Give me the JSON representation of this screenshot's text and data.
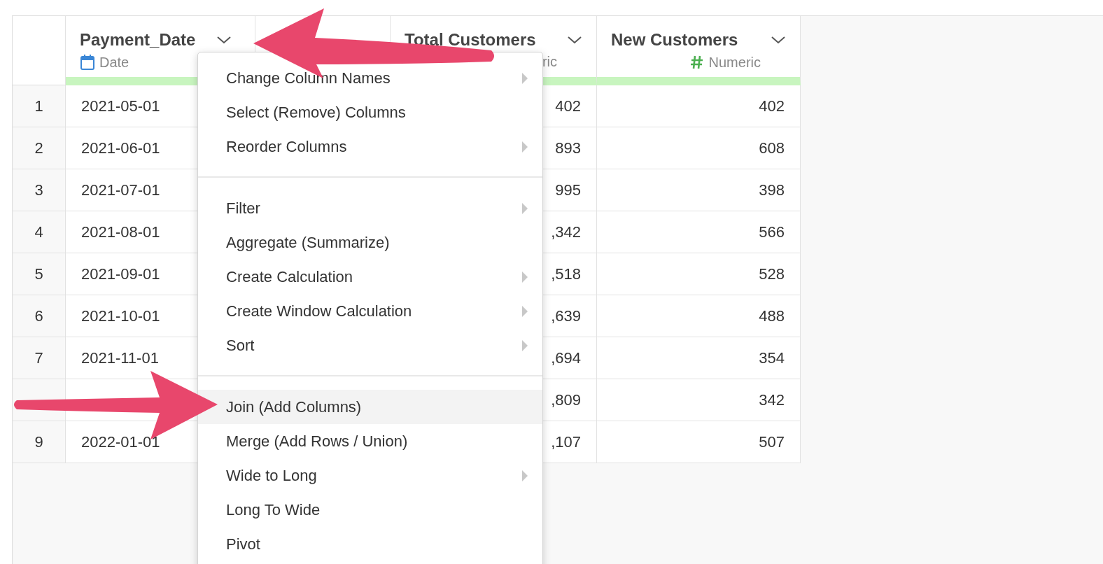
{
  "table": {
    "columns": [
      {
        "name": "Payment_Date",
        "kind": "date",
        "type": "Date"
      },
      {
        "kind": "covered"
      },
      {
        "name": "Total Customers",
        "kind": "plain",
        "type": "ric"
      },
      {
        "name": "New Customers",
        "kind": "numeric",
        "type": "Numeric"
      }
    ],
    "rows": [
      {
        "number": "1",
        "cells": [
          "2021-05-01",
          "402",
          "402"
        ]
      },
      {
        "number": "2",
        "cells": [
          "2021-06-01",
          "893",
          "608"
        ]
      },
      {
        "number": "3",
        "cells": [
          "2021-07-01",
          "995",
          "398"
        ]
      },
      {
        "number": "4",
        "cells": [
          "2021-08-01",
          ",342",
          "566"
        ]
      },
      {
        "number": "5",
        "cells": [
          "2021-09-01",
          ",518",
          "528"
        ]
      },
      {
        "number": "6",
        "cells": [
          "2021-10-01",
          ",639",
          "488"
        ]
      },
      {
        "number": "7",
        "cells": [
          "2021-11-01",
          ",694",
          "354"
        ]
      },
      {
        "cells": [
          null,
          ",809",
          "342"
        ]
      },
      {
        "number": "9",
        "cells": [
          "2022-01-01",
          ",107",
          "507"
        ]
      }
    ]
  },
  "column_menu": {
    "sections": [
      [
        {
          "label": "Change Column Names",
          "submenu": true,
          "selected": false
        },
        {
          "label": "Select (Remove) Columns",
          "submenu": false,
          "selected": false
        },
        {
          "label": "Reorder Columns",
          "submenu": true,
          "selected": false
        }
      ],
      [
        {
          "label": "Filter",
          "submenu": true,
          "selected": false
        },
        {
          "label": "Aggregate (Summarize)",
          "submenu": false,
          "selected": false
        },
        {
          "label": "Create Calculation",
          "submenu": true,
          "selected": false
        },
        {
          "label": "Create Window Calculation",
          "submenu": true,
          "selected": false
        },
        {
          "label": "Sort",
          "submenu": true,
          "selected": false
        }
      ],
      [
        {
          "label": "Join (Add Columns)",
          "submenu": false,
          "selected": true
        },
        {
          "label": "Merge (Add Rows / Union)",
          "submenu": false,
          "selected": false
        },
        {
          "label": "Wide to Long",
          "submenu": true,
          "selected": false
        },
        {
          "label": "Long To Wide",
          "submenu": false,
          "selected": false
        },
        {
          "label": "Pivot",
          "submenu": false,
          "selected": false
        }
      ]
    ]
  }
}
